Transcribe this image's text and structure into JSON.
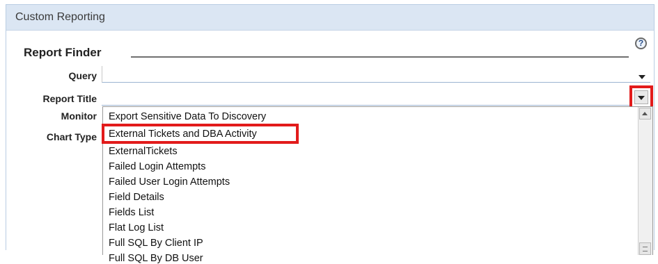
{
  "panel": {
    "title": "Custom Reporting"
  },
  "finder": {
    "title": "Report Finder",
    "help_icon": "?",
    "labels": {
      "query": "Query",
      "report_title": "Report Title",
      "monitor": "Monitor",
      "chart_type": "Chart Type"
    },
    "query_value": "",
    "report_title_value": ""
  },
  "dropdown": {
    "options": [
      "Export Sensitive Data To Discovery",
      "External Tickets and DBA Activity",
      "ExternalTickets",
      "Failed Login Attempts",
      "Failed User Login Attempts",
      "Field Details",
      "Fields List",
      "Flat Log List",
      "Full SQL By Client IP",
      "Full SQL By DB User"
    ],
    "highlighted_option": "External Tickets and DBA Activity"
  },
  "colors": {
    "highlight": "#e21b1b",
    "header_bg": "#dbe6f3"
  },
  "icons": {
    "help": "help-icon",
    "dropdown": "chevron-down-icon"
  }
}
